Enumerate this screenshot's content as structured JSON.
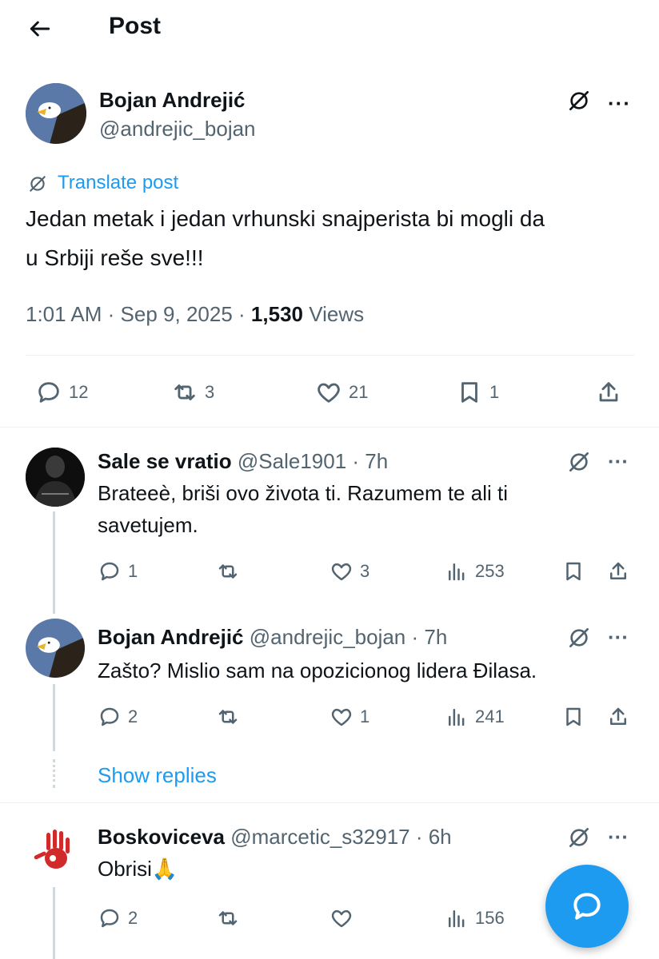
{
  "header": {
    "title": "Post",
    "back_icon": "arrow-left-icon"
  },
  "post": {
    "author_name": "Bojan Andrejić",
    "author_handle": "@andrejic_bojan",
    "translate_label": "Translate post",
    "text_line1": "Jedan metak i jedan vrhunski snajperista bi mogli da",
    "text_line2": "u Srbiji reše sve!!!",
    "time": "1:01 AM",
    "sep": "·",
    "date": "Sep 9, 2025",
    "views_count": "1,530",
    "views_label": "Views",
    "actions": {
      "replies": "12",
      "reposts": "3",
      "likes": "21",
      "bookmarks": "1"
    }
  },
  "replies": [
    {
      "name": "Sale se vratio",
      "handle_time": "@Sale1901 · 7h",
      "text_line1": "Brateeè, briši ovo života ti. Razumem te ali ti",
      "text_line2": "savetujem.",
      "replies": "1",
      "reposts": "",
      "likes": "3",
      "views": "253"
    },
    {
      "name": "Bojan Andrejić",
      "handle_time": "@andrejic_bojan · 7h",
      "text_line1": "Zašto? Mislio sam na opozicionog lidera Đilasa.",
      "replies": "2",
      "reposts": "",
      "likes": "1",
      "views": "241"
    },
    {
      "name": "Boskoviceva",
      "handle_time": "@marcetic_s32917 · 6h",
      "text_line1": "Obrisi🙏",
      "replies": "2",
      "reposts": "",
      "likes": "",
      "views": "156"
    }
  ],
  "show_replies": "Show replies",
  "colors": {
    "accent": "#1d9bf0",
    "text": "#0f1419",
    "muted": "#536471",
    "divider": "#eff3f4"
  }
}
